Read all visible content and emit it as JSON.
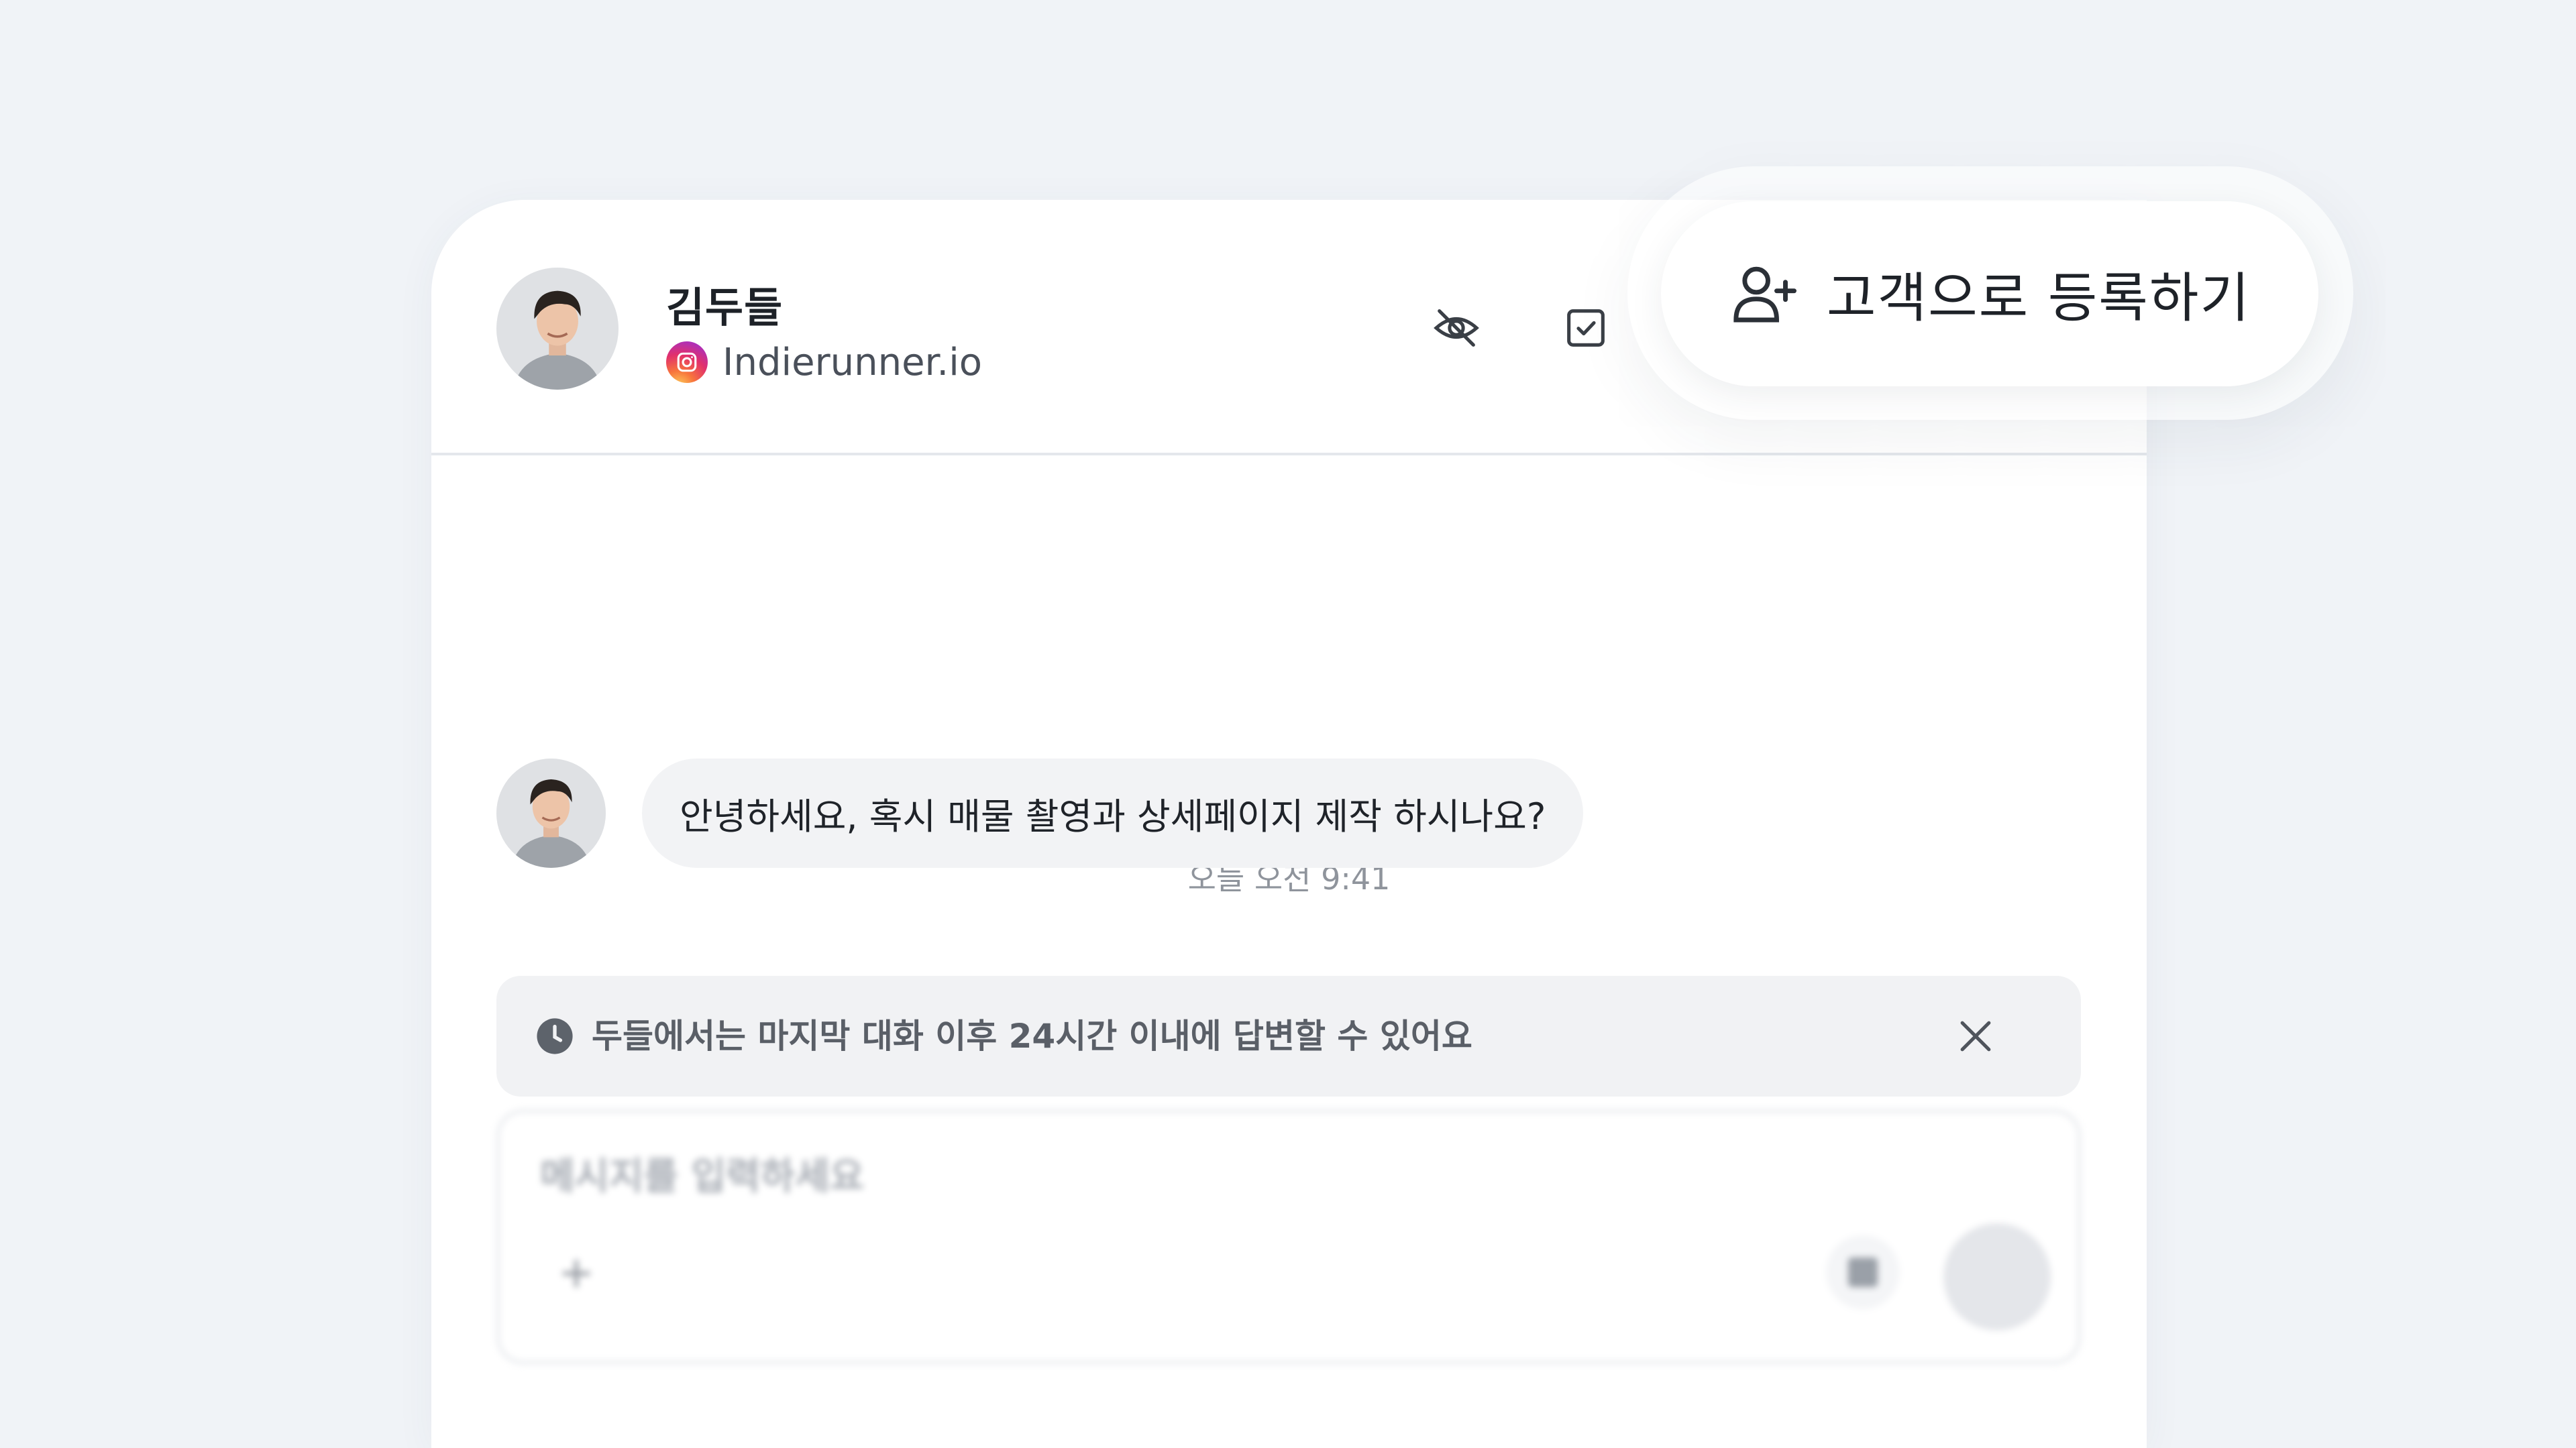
{
  "header": {
    "name": "김두들",
    "source_icon": "instagram-icon",
    "source": "Indierunner.io",
    "hide_icon": "eye-off-icon",
    "done_icon": "checkbox-icon"
  },
  "register_button": {
    "label": "고객으로 등록하기",
    "icon": "user-plus-icon"
  },
  "conversation": {
    "timestamp": "오늘 오전 9:41",
    "messages": [
      {
        "from": "customer",
        "text": "안녕하세요, 혹시 매물 촬영과 상세페이지 제작 하시나요?"
      }
    ]
  },
  "notice": {
    "text": "두들에서는 마지막 대화 이후 24시간 이내에 답변할 수 있어요",
    "icon": "clock-icon"
  },
  "composer": {
    "placeholder": "메시지를 입력하세요"
  },
  "colors": {
    "background": "#f0f3f7",
    "bubble": "#f2f3f5",
    "notice": "#f1f2f4",
    "text": "#1f2329"
  }
}
